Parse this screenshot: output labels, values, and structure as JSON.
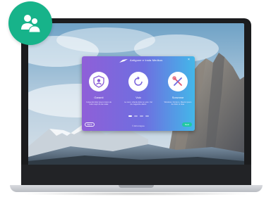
{
  "dialog": {
    "title": "Antigone e Insta Medkus",
    "close_glyph": "×",
    "features": [
      {
        "icon": "shield-person-icon",
        "title": "Garantí",
        "desc": "Culpa del dolor ipsum lorem de todo mejor de las velas"
      },
      {
        "icon": "refresh-icon",
        "title": "Voix",
        "desc": "La recur. Liberte dolor en esto. Vel de maguinhe alteris"
      },
      {
        "icon": "tools-icon",
        "title": "Sorunear",
        "desc": "Windows. No Est s. Mauris ipsum de dolor ut vitae"
      }
    ],
    "back_label": "Back",
    "next_label": "Next",
    "footer": "© 2021 Antigone"
  },
  "colors": {
    "badge": "#17b38a",
    "dialog_start": "#8f5fd8",
    "dialog_end": "#43b7e9",
    "next_button": "#21c9a0"
  }
}
